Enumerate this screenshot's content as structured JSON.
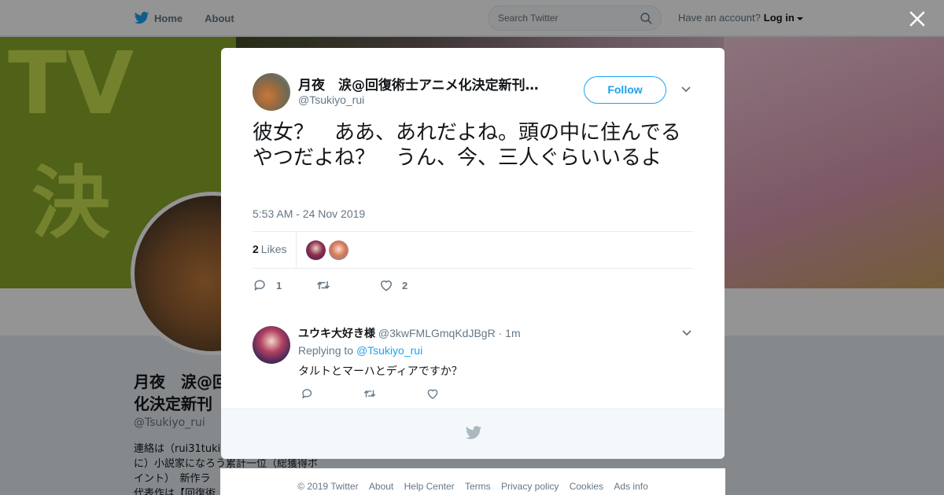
{
  "nav": {
    "home_label": "Home",
    "about_label": "About",
    "search_placeholder": "Search Twitter",
    "account_prompt": "Have an account?",
    "login_label": "Log in"
  },
  "background_profile": {
    "name": "月夜　涙@回\n化決定新刊",
    "handle": "@Tsukiyo_rui",
    "bio": "連絡は（rui31tuki\nに）小説家になろう累計一位（総獲得ポ\nイント）　新作ラ\n代表作は【回復術"
  },
  "tweet": {
    "author_name": "月夜　涙@回復術士アニメ化決定新刊アニメ化",
    "author_handle": "@Tsukiyo_rui",
    "follow_label": "Follow",
    "text": "彼女？　ああ、あれだよね。頭の中に住んでるやつだよね？　うん、今、三人ぐらいいるよ",
    "timestamp": "5:53 AM - 24 Nov 2019",
    "likes_count": "2",
    "likes_label": "Likes",
    "reply_count": "1",
    "retweet_count": "",
    "like_count": "2"
  },
  "reply": {
    "name": "ユウキ大好き様",
    "handle": "@3kwFMLGmqKdJBgR",
    "separator": "·",
    "time": "1m",
    "replying_prefix": "Replying to",
    "replying_to": "@Tsukiyo_rui",
    "text": "タルトとマーハとディアですか？"
  },
  "footer": {
    "copyright": "© 2019 Twitter",
    "links": [
      "About",
      "Help Center",
      "Terms",
      "Privacy policy",
      "Cookies",
      "Ads info"
    ]
  },
  "colors": {
    "accent": "#1da1f2",
    "secondary_text": "#657786",
    "primary_text": "#14171a",
    "overlay": "rgba(0,0,0,0.42)"
  },
  "icons": [
    "twitter-bird-icon",
    "search-icon",
    "caret-down-icon",
    "close-icon",
    "reply-icon",
    "retweet-icon",
    "heart-icon",
    "chevron-down-icon"
  ]
}
